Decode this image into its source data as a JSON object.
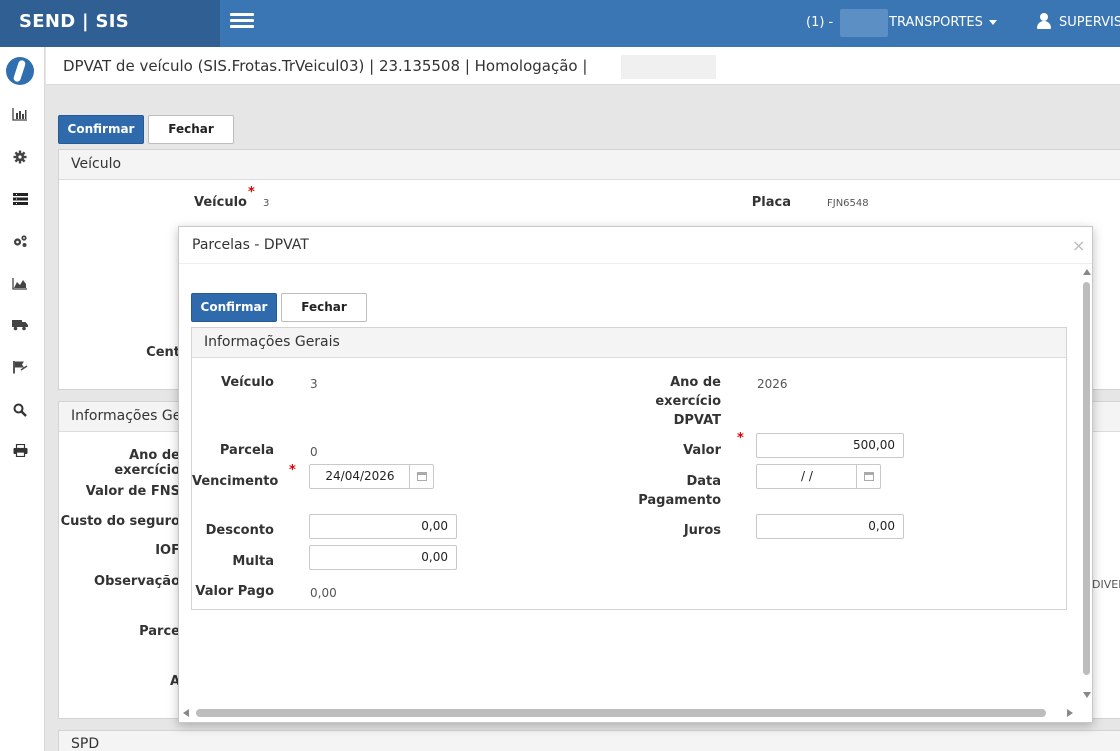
{
  "topbar": {
    "brand": "SEND | SIS",
    "user_number": "(1) -",
    "company": "TRANSPORTES",
    "user": "SUPERVIS"
  },
  "page": {
    "title": "DPVAT de veículo (SIS.Frotas.TrVeicul03) | 23.135508 | Homologação |"
  },
  "toolbar": {
    "confirm_label": "Confirmar",
    "close_label": "Fechar"
  },
  "background": {
    "panel_veiculo": {
      "heading": "Veículo",
      "veiculo_label": "Veículo",
      "veiculo_value": "3",
      "placa_label": "Placa",
      "placa_value": "FJN6548",
      "centro_label": "Cent"
    },
    "panel_info": {
      "heading": "Informações Gera",
      "ano_label": "Ano de exercício",
      "valor_fns_label": "Valor de FNS",
      "custo_label": "Custo do seguro",
      "iof_label": "IOF",
      "observacao_label": "Observação",
      "parcela_label": "Parce",
      "a_label": "A",
      "right_text": "DIVER"
    },
    "panel_spd": {
      "heading": "SPD"
    }
  },
  "modal": {
    "title": "Parcelas - DPVAT",
    "close_symbol": "×",
    "confirm_label": "Confirmar",
    "close_label": "Fechar",
    "section_heading": "Informações Gerais",
    "veiculo_label": "Veículo",
    "veiculo_value": "3",
    "ano_label_1": "Ano de",
    "ano_label_2": "exercício",
    "ano_label_3": "DPVAT",
    "ano_value": "2026",
    "parcela_label": "Parcela",
    "parcela_value": "0",
    "valor_label": "Valor",
    "valor_value": "500,00",
    "vencimento_label": "Vencimento",
    "vencimento_value": "24/04/2026",
    "data_pagamento_label_1": "Data",
    "data_pagamento_label_2": "Pagamento",
    "data_pagamento_value": "/ /",
    "desconto_label": "Desconto",
    "desconto_value": "0,00",
    "juros_label": "Juros",
    "juros_value": "0,00",
    "multa_label": "Multa",
    "multa_value": "0,00",
    "valor_pago_label": "Valor Pago",
    "valor_pago_value": "0,00"
  },
  "sidebar": {
    "icons": [
      "logo-icon",
      "chart-bar-icon",
      "gear-icon",
      "list-icon",
      "gears-icon",
      "area-chart-icon",
      "truck-icon",
      "flag-icon",
      "search-icon",
      "print-icon"
    ]
  },
  "colors": {
    "topbar": "#3a76b4",
    "brand_bg": "#2f5f93",
    "primary": "#2f6aad",
    "required": "#dd0000"
  }
}
